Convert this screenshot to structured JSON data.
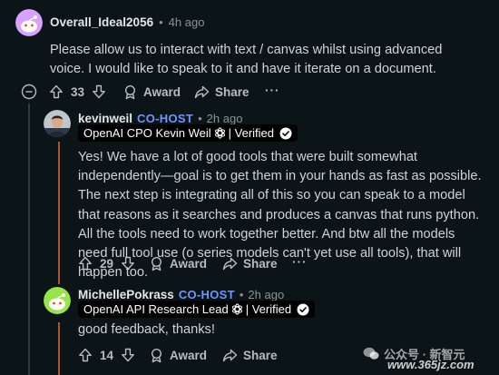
{
  "comments": [
    {
      "username": "Overall_Ideal2056",
      "time": "4h ago",
      "body": "Please allow us to interact with text / canvas whilst using advanced voice. I would like to speak to it and have it iterate on a document.",
      "votes": "33",
      "award_label": "Award",
      "share_label": "Share",
      "avatar_color": "#d8a0ff"
    },
    {
      "username": "kevinweil",
      "role_badge": "CO-HOST",
      "time": "2h ago",
      "flair_prefix": "OpenAI CPO Kevin Weil",
      "flair_suffix": "| Verified",
      "body": "Yes! We have a lot of good tools that were built somewhat independently—goal is to get them in your hands as fast as possible. The next step is integrating all of this so you can speak to a model that reasons as it searches and produces a canvas that runs python. All the tools need to work together better. And btw all the models need full tool use (o series models can't yet use all tools), that will happen too.",
      "votes": "29",
      "award_label": "Award",
      "share_label": "Share"
    },
    {
      "username": "MichellePokrass",
      "role_badge": "CO-HOST",
      "time": "2h ago",
      "flair_prefix": "OpenAI API Research Lead",
      "flair_suffix": "| Verified",
      "body": "good feedback, thanks!",
      "votes": "14",
      "award_label": "Award",
      "share_label": "Share",
      "avatar_color": "#9be34a"
    }
  ],
  "separator": "•",
  "more_label": "···",
  "watermark": {
    "brand": "公众号 · 新智元",
    "url": "www.365jz.com"
  },
  "colors": {
    "background": "#0b1416",
    "cohost": "#6e94ff",
    "thread_line": "#323a3d"
  }
}
